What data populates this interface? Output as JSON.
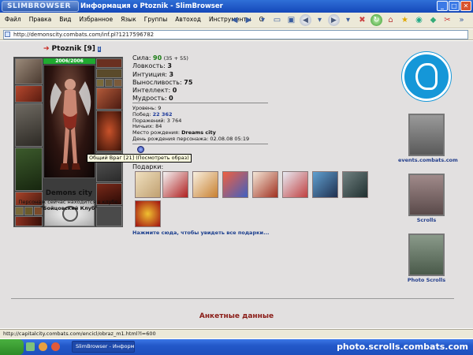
{
  "window": {
    "logo": "SLIMBROWSER",
    "title": "Информация о Ptoznik - SlimBrowser"
  },
  "menu": [
    "Файл",
    "Правка",
    "Вид",
    "Избранное",
    "Язык",
    "Группы",
    "Автоход",
    "Инструменты",
    "О"
  ],
  "address": "http://demonscity.combats.com/inf.pl?1217596782",
  "character": {
    "name": "Ptoznik",
    "level": "[9]",
    "hp": "2006/2006",
    "city": "Demons city",
    "club_line": "Персонаж сейчас находится в клубе.",
    "club_name": "\"Бойцовский Клуб\""
  },
  "stats": [
    {
      "label": "Сила:",
      "value": "90",
      "extra": "(35 + 55)"
    },
    {
      "label": "Ловкость:",
      "value": "3",
      "extra": ""
    },
    {
      "label": "Интуиция:",
      "value": "3",
      "extra": ""
    },
    {
      "label": "Выносливость:",
      "value": "75",
      "extra": ""
    },
    {
      "label": "Интеллект:",
      "value": "0",
      "extra": ""
    },
    {
      "label": "Мудрость:",
      "value": "0",
      "extra": ""
    }
  ],
  "details": {
    "level_label": "Уровень:",
    "level_value": "9",
    "wins_label": "Побед:",
    "wins_value": "22 362",
    "losses_label": "Поражений:",
    "losses_value": "3 764",
    "draws_label": "Ничьих:",
    "draws_value": "84",
    "birthplace_label": "Место рождения:",
    "birthplace_value": "Dreams city",
    "birthday_label": "День рождения персонажа:",
    "birthday_value": "02.08.08 05:19"
  },
  "tooltip": "Общий Враг [21] (Посмотреть образ)",
  "gifts_label": "Подарки:",
  "gifts_link": "Нажмите сюда, чтобы увидеть все подарки...",
  "side": {
    "events": "events.combats.com",
    "scrolls": "Scrolls",
    "photo": "Photo Scrolls"
  },
  "anketa": "Анкетные данные",
  "status_url": "http://capitalcity.combats.com/encicl/obraz_m1.html?l=600",
  "taskbar": {
    "start": "",
    "task": "SlimBrowser - Информ...",
    "watermark": "photo.scrolls.combats.com"
  }
}
